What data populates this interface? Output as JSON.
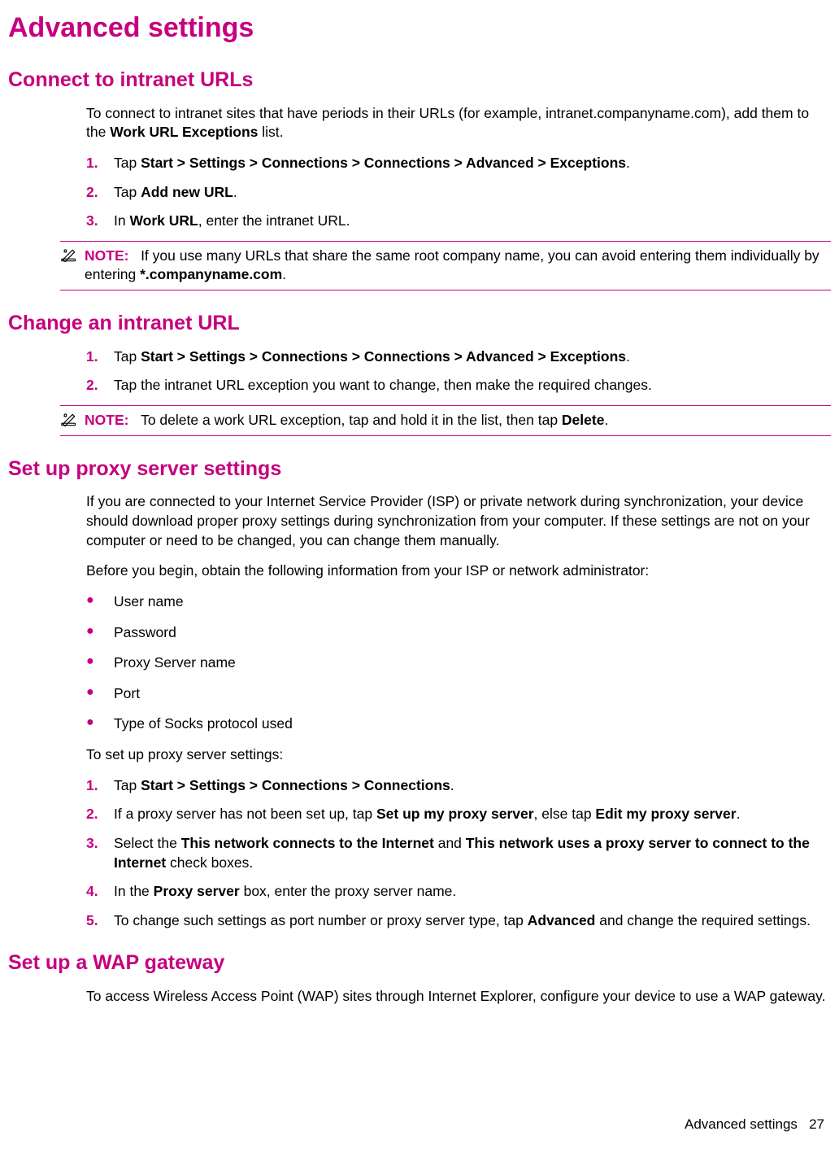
{
  "title": "Advanced settings",
  "sections": {
    "connect": {
      "heading": "Connect to intranet URLs",
      "intro_a": "To connect to intranet sites that have periods in their URLs (for example, intranet.companyname.com), add them to the ",
      "intro_b": "Work URL Exceptions",
      "intro_c": " list.",
      "steps": {
        "s1_a": "Tap ",
        "s1_b": "Start > Settings > Connections > Connections > Advanced > Exceptions",
        "s1_c": ".",
        "s2_a": "Tap ",
        "s2_b": "Add new URL",
        "s2_c": ".",
        "s3_a": "In ",
        "s3_b": "Work URL",
        "s3_c": ", enter the intranet URL."
      },
      "note_label": "NOTE:",
      "note_a": "If you use many URLs that share the same root company name, you can avoid entering them individually by entering ",
      "note_b": "*.companyname.com",
      "note_c": "."
    },
    "change": {
      "heading": "Change an intranet URL",
      "steps": {
        "s1_a": "Tap ",
        "s1_b": "Start > Settings > Connections > Connections > Advanced > Exceptions",
        "s1_c": ".",
        "s2": "Tap the intranet URL exception you want to change, then make the required changes."
      },
      "note_label": "NOTE:",
      "note_a": "To delete a work URL exception, tap and hold it in the list, then tap ",
      "note_b": "Delete",
      "note_c": "."
    },
    "proxy": {
      "heading": "Set up proxy server settings",
      "intro1": "If you are connected to your Internet Service Provider (ISP) or private network during synchronization, your device should download proper proxy settings during synchronization from your computer. If these settings are not on your computer or need to be changed, you can change them manually.",
      "intro2": "Before you begin, obtain the following information from your ISP or network administrator:",
      "bullets": {
        "b1": "User name",
        "b2": "Password",
        "b3": "Proxy Server name",
        "b4": "Port",
        "b5": "Type of Socks protocol used"
      },
      "intro3": "To set up proxy server settings:",
      "steps": {
        "s1_a": "Tap ",
        "s1_b": "Start > Settings > Connections > Connections",
        "s1_c": ".",
        "s2_a": "If a proxy server has not been set up, tap ",
        "s2_b": "Set up my proxy server",
        "s2_c": ", else tap ",
        "s2_d": "Edit my proxy server",
        "s2_e": ".",
        "s3_a": "Select the ",
        "s3_b": "This network connects to the Internet",
        "s3_c": " and ",
        "s3_d": "This network uses a proxy server to connect to the Internet",
        "s3_e": " check boxes.",
        "s4_a": "In the ",
        "s4_b": "Proxy server",
        "s4_c": " box, enter the proxy server name.",
        "s5_a": "To change such settings as port number or proxy server type, tap ",
        "s5_b": "Advanced",
        "s5_c": " and change the required settings."
      }
    },
    "wap": {
      "heading": "Set up a WAP gateway",
      "intro": "To access Wireless Access Point (WAP) sites through Internet Explorer, configure your device to use a WAP gateway."
    }
  },
  "footer": {
    "label": "Advanced settings",
    "page": "27"
  }
}
